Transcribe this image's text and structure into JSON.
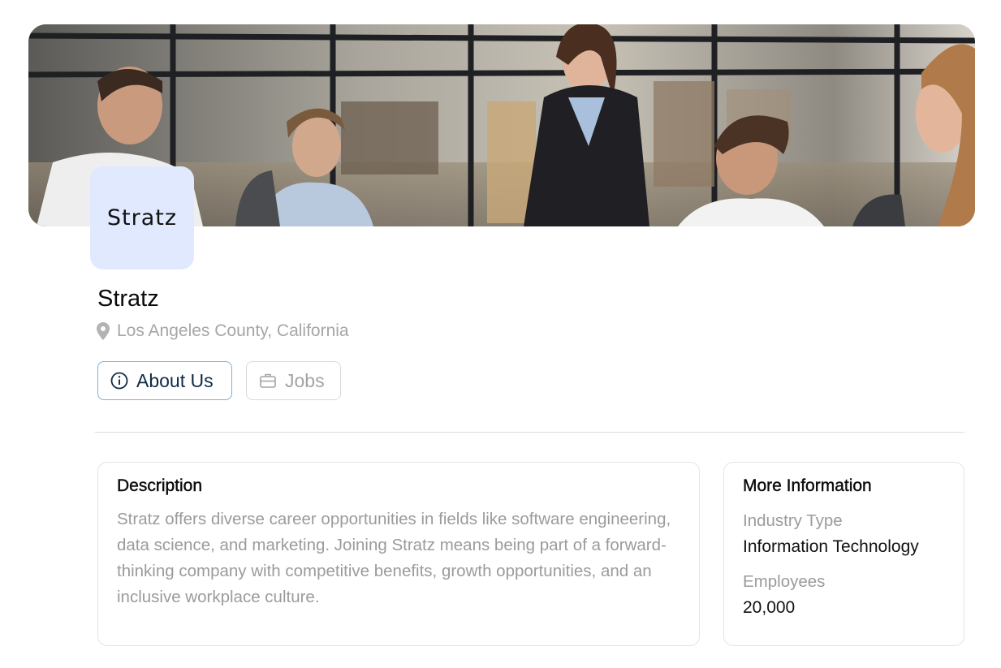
{
  "company": {
    "logo_text": "Stratz",
    "name": "Stratz",
    "location": "Los Angeles County, California"
  },
  "tabs": [
    {
      "label": "About Us",
      "icon": "info-circle-icon",
      "active": true
    },
    {
      "label": "Jobs",
      "icon": "briefcase-icon",
      "active": false
    }
  ],
  "description": {
    "title": "Description",
    "text": "Stratz offers diverse career opportunities in fields like software engineering, data science, and marketing. Joining Stratz means being part of a forward-thinking company with competitive benefits, growth opportunities, and an inclusive workplace culture."
  },
  "more_info": {
    "title": "More Information",
    "industry_label": "Industry Type",
    "industry_value": "Information Technology",
    "employees_label": "Employees",
    "employees_value": "20,000"
  },
  "colors": {
    "logo_bg": "#e0e9fd",
    "active_tab_border": "#7fb0d6",
    "active_tab_text": "#0f2a45",
    "muted_text": "#9b9b9b"
  }
}
